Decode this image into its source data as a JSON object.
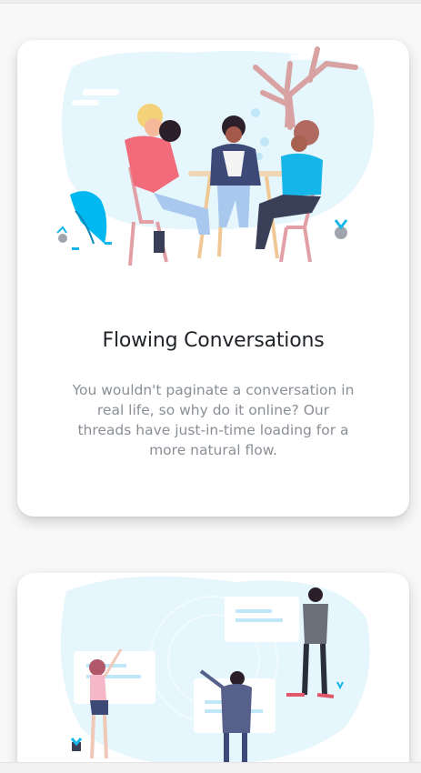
{
  "features": [
    {
      "title": "Flowing Conversations",
      "description": "You wouldn't paginate a conversation in real life, so why do it online? Our threads have just-in-time loading for a more natural flow.",
      "illustration": "people-talking-at-table-illustration"
    },
    {
      "title": "",
      "description": "",
      "illustration": "people-with-chat-bubbles-illustration"
    }
  ],
  "colors": {
    "accent": "#00B0F0",
    "illustration_bg": "#E6F6FD",
    "tree": "#D9A2A2",
    "text_heading": "#1F2328",
    "text_body": "#8A8F96"
  }
}
